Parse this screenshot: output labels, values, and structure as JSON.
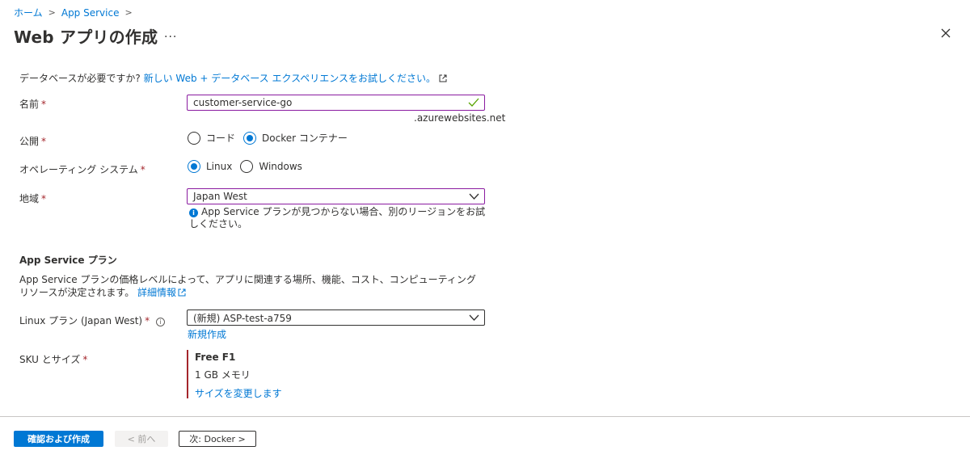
{
  "breadcrumb": {
    "home": "ホーム",
    "app_service": "App Service"
  },
  "page_title": "Web アプリの作成",
  "more_label": "...",
  "notice": {
    "text": "データベースが必要ですか? ",
    "link": "新しい Web + データベース エクスペリエンスをお試しください。"
  },
  "fields": {
    "name": {
      "label": "名前",
      "required": "*",
      "value": "customer-service-go",
      "suffix": ".azurewebsites.net"
    },
    "publish": {
      "label": "公開",
      "required": "*",
      "options": [
        "コード",
        "Docker コンテナー"
      ],
      "selected": "Docker コンテナー"
    },
    "os": {
      "label": "オペレーティング システム",
      "required": "*",
      "options": [
        "Linux",
        "Windows"
      ],
      "selected": "Linux"
    },
    "region": {
      "label": "地域",
      "required": "*",
      "value": "Japan West",
      "info": "App Service プランが見つからない場合、別のリージョンをお試しください。"
    }
  },
  "plan_section": {
    "title": "App Service プラン",
    "description": "App Service プランの価格レベルによって、アプリに関連する場所、機能、コスト、コンピューティング リソースが決定されます。",
    "more_info_link": "詳細情報",
    "linux_plan": {
      "label": "Linux プラン (Japan West)",
      "required": "*",
      "value": "(新規) ASP-test-a759",
      "create_new": "新規作成"
    },
    "sku": {
      "label": "SKU とサイズ",
      "required": "*",
      "name": "Free F1",
      "memory": "1 GB メモリ",
      "change_link": "サイズを変更します"
    }
  },
  "footer": {
    "review_create": "確認および作成",
    "previous": "< 前へ",
    "next": "次: Docker >"
  },
  "colors": {
    "accent": "#0078d4",
    "required": "#a4262c",
    "focus_border": "#8a1ba0"
  }
}
